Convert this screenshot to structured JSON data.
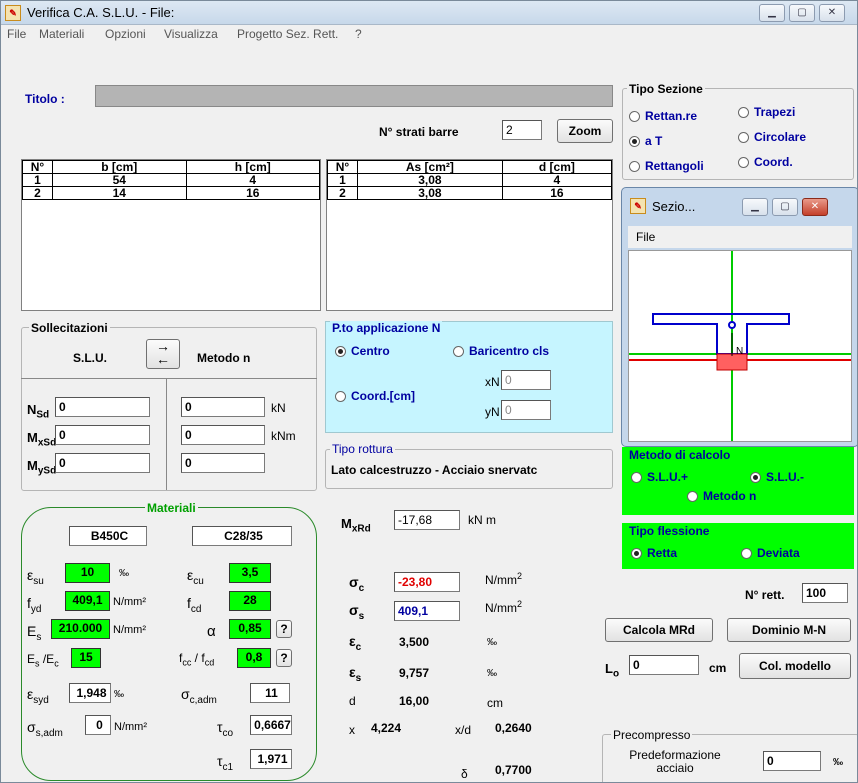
{
  "window": {
    "title": "Verifica C.A. S.L.U. - File:"
  },
  "menu": [
    "File",
    "Materiali",
    "Opzioni",
    "Visualizza",
    "Progetto Sez. Rett.",
    "?"
  ],
  "titolo": {
    "label": "Titolo :",
    "value": ""
  },
  "strati": {
    "label": "N° strati barre",
    "value": "2",
    "zoom": "Zoom"
  },
  "tipo_sezione": {
    "title": "Tipo Sezione",
    "options": [
      "Rettan.re",
      "Trapezi",
      "a T",
      "Circolare",
      "Rettangoli",
      "Coord."
    ],
    "selected": "a T"
  },
  "geom_table": {
    "headers": [
      "N°",
      "b [cm]",
      "h [cm]"
    ],
    "rows": [
      [
        "1",
        "54",
        "4"
      ],
      [
        "2",
        "14",
        "16"
      ]
    ]
  },
  "bars_table": {
    "headers": [
      "N°",
      "As [cm²]",
      "d [cm]"
    ],
    "rows": [
      [
        "1",
        "3,08",
        "4"
      ],
      [
        "2",
        "3,08",
        "16"
      ]
    ]
  },
  "sezione_window": {
    "title": "Sezio...",
    "menu": "File",
    "n_label": "N"
  },
  "sollecitazioni": {
    "title": "Sollecitazioni",
    "slu": "S.L.U.",
    "metodo_n": "Metodo n",
    "arrow_right": "→",
    "arrow_left": "←",
    "nsd": "N",
    "nsd_sub": "Sd",
    "mxsd": "M",
    "mxsd_sub": "xSd",
    "mysd": "M",
    "mysd_sub": "ySd",
    "nsd_val": "0",
    "mxsd_val": "0",
    "mysd_val": "0",
    "nsd_n": "0",
    "mxsd_n": "0",
    "mysd_n": "0",
    "unit_kn": "kN",
    "unit_knm": "kNm"
  },
  "pto": {
    "title": "P.to applicazione N",
    "centro": "Centro",
    "baricentro": "Baricentro cls",
    "coord": "Coord.[cm]",
    "xn": "xN",
    "yn": "yN",
    "xn_val": "0",
    "yn_val": "0"
  },
  "rottura": {
    "title": "Tipo rottura",
    "value": "Lato calcestruzzo - Acciaio snervatc"
  },
  "metodo": {
    "title": "Metodo di calcolo",
    "slu_plus": "S.L.U.+",
    "slu_minus": "S.L.U.-",
    "metodo_n": "Metodo n"
  },
  "flessione": {
    "title": "Tipo flessione",
    "retta": "Retta",
    "deviata": "Deviata"
  },
  "materiali": {
    "title": "Materiali",
    "steel": "B450C",
    "concrete": "C28/35",
    "esu": "10",
    "esu_unit": "‰",
    "fyd": "409,1",
    "fyd_unit": "N/mm²",
    "es": "210.000",
    "es_unit": "N/mm²",
    "es_ec": "15",
    "esyd": "1,948",
    "esyd_unit": "‰",
    "ssadm": "0",
    "ssadm_unit": "N/mm²",
    "ecu": "3,5",
    "fcd": "28",
    "alpha": "0,85",
    "fcc_fcd": "0,8",
    "scadm": "11",
    "tco": "0,6667",
    "tc1": "1,971",
    "q": "?"
  },
  "results": {
    "mxrd": "-17,68",
    "mxrd_unit": "kN m",
    "sc": "-23,80",
    "sc_unit": "N/mm",
    "ss": "409,1",
    "ss_unit": "N/mm",
    "ec": "3,500",
    "ec_unit": "‰",
    "es": "9,757",
    "es_unit": "‰",
    "d": "16,00",
    "d_unit": "cm",
    "x": "4,224",
    "xd_label": "x/d",
    "xd": "0,2640",
    "delta": "0,7700",
    "sq": "2"
  },
  "rett": {
    "label": "N° rett.",
    "value": "100"
  },
  "buttons": {
    "calcola": "Calcola MRd",
    "dominio": "Dominio M-N",
    "col": "Col. modello"
  },
  "lo": {
    "label": "L",
    "sub": "o",
    "value": "0",
    "unit": "cm"
  },
  "precompresso": {
    "title": "Precompresso",
    "label": "Predeformazione acciaio",
    "value": "0",
    "unit": "‰"
  }
}
